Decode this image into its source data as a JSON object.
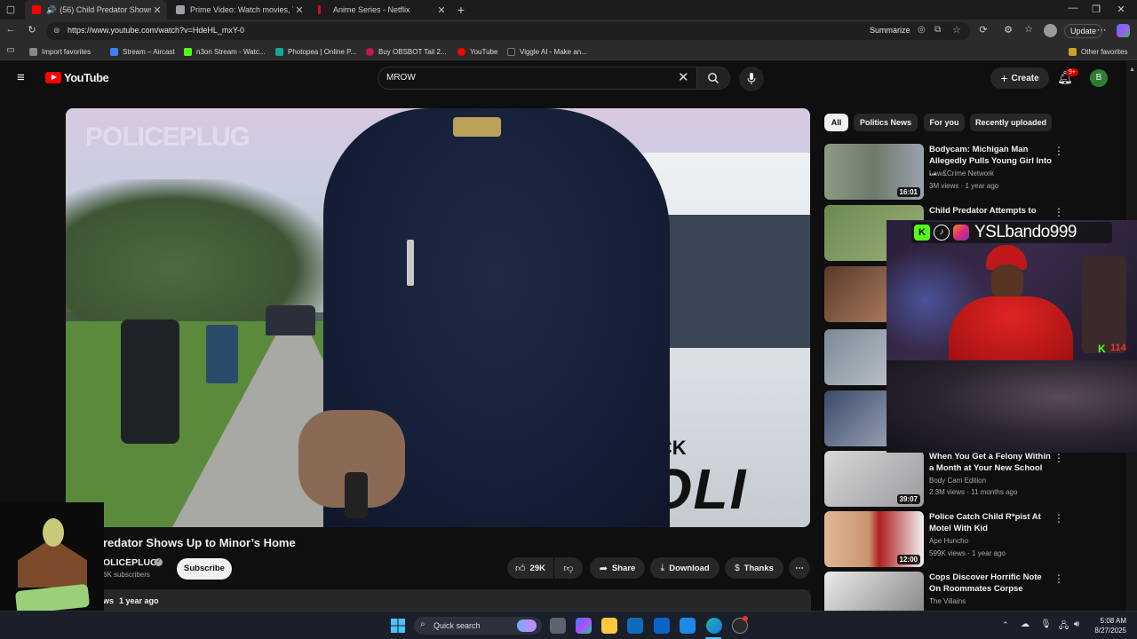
{
  "browser": {
    "tabs": [
      {
        "label": "(56) Child Predator Shows Up",
        "color": "#ff0000"
      },
      {
        "label": "Prime Video: Watch movies, TV sh",
        "color": "#9aa0a6"
      },
      {
        "label": "Anime Series - Netflix",
        "color": "#e50914"
      }
    ],
    "url": "https://www.youtube.com/watch?v=HdeHL_mxY-0",
    "summarize_label": "Summarize",
    "update_label": "Update",
    "bookmarks": [
      {
        "label": "Import favorites",
        "color": "#888888"
      },
      {
        "label": "Stream – Aircast",
        "color": "#3b82f6"
      },
      {
        "label": "n3on Stream - Watc...",
        "color": "#53fc18"
      },
      {
        "label": "Photopea | Online P...",
        "color": "#18a497"
      },
      {
        "label": "Buy OBSBOT Tail 2...",
        "color": "#c2185b"
      },
      {
        "label": "YouTube",
        "color": "#ff0000"
      },
      {
        "label": "Viggle AI - Make an...",
        "color": "#222222"
      }
    ],
    "other_favorites": "Other favorites"
  },
  "youtube": {
    "logo_text": "YouTube",
    "search_value": "MROW",
    "create_label": "Create",
    "notif_badge": "9+",
    "avatar_letter": "B"
  },
  "video": {
    "watermark": "POLICEPLUG",
    "car_text_1": "WICK",
    "car_text_2": "POLI",
    "title": "redator Shows Up to Minor’s Home",
    "channel": "OLICEPLUG",
    "subscribers": "6K subscribers",
    "subscribe_label": "Subscribe",
    "likes": "29K",
    "share_label": "Share",
    "download_label": "Download",
    "thanks_label": "Thanks",
    "views_prefix": "ws",
    "posted": "1 year ago"
  },
  "chips": [
    "All",
    "Politics News",
    "For you",
    "Recently uploaded"
  ],
  "recommendations": [
    {
      "title": "Bodycam: Michigan Man Allegedly Pulls Young Girl Into ...",
      "channel": "Law&Crime Network",
      "meta": "3M views · 1 year ago",
      "duration": "16:01"
    },
    {
      "title": "Child Predator Attempts to",
      "channel": "",
      "meta": "",
      "duration": ""
    },
    {
      "title": "",
      "channel": "",
      "meta": "",
      "duration": ""
    },
    {
      "title": "",
      "channel": "",
      "meta": "",
      "duration": ""
    },
    {
      "title": "",
      "channel": "",
      "meta": "",
      "duration": ""
    },
    {
      "title": "When You Get a Felony Within a Month at Your New School",
      "channel": "Body Cam Edition",
      "meta": "2.3M views · 11 months ago",
      "duration": "39:07"
    },
    {
      "title": "Police Catch Child R*pist At Motel With Kid",
      "channel": "Ape Huncho",
      "meta": "599K views · 1 year ago",
      "duration": "12:00"
    },
    {
      "title": "Cops Discover Horrific Note On Roommates Corpse",
      "channel": "The Villains",
      "meta": "",
      "duration": ""
    }
  ],
  "stream_overlay": {
    "handle": "YSLbando999",
    "viewers": "114"
  },
  "taskbar": {
    "search_placeholder": "Quick search",
    "time": "5:08 AM",
    "date": "8/27/2025"
  }
}
